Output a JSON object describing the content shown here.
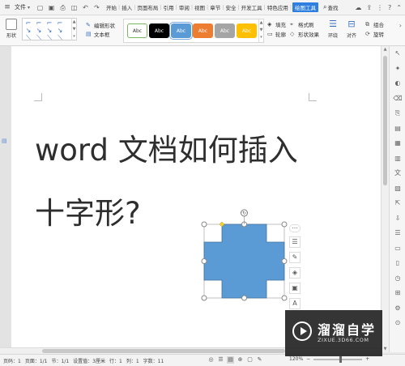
{
  "menubar": {
    "file_label": "文件",
    "tabs": [
      "开始",
      "插入",
      "页面布局",
      "引用",
      "审阅",
      "视图",
      "章节",
      "安全",
      "开发工具",
      "特色应用"
    ],
    "active_tab": "绘图工具",
    "search_label": "查找"
  },
  "ribbon": {
    "shape_label": "形状",
    "edit_shape_label": "编辑形状",
    "textbox_label": "文本框",
    "style_swatches": [
      {
        "label": "Abc",
        "bg": "#ffffff",
        "fg": "#333333",
        "border": "#7bb661"
      },
      {
        "label": "Abc",
        "bg": "#000000",
        "fg": "#ffffff",
        "border": "#000000"
      },
      {
        "label": "Abc",
        "bg": "#5b9bd5",
        "fg": "#ffffff",
        "border": "#5b9bd5"
      },
      {
        "label": "Abc",
        "bg": "#ed7d31",
        "fg": "#ffffff",
        "border": "#ed7d31"
      },
      {
        "label": "Abc",
        "bg": "#a5a5a5",
        "fg": "#ffffff",
        "border": "#a5a5a5"
      },
      {
        "label": "Abc",
        "bg": "#ffc000",
        "fg": "#ffffff",
        "border": "#ffc000"
      }
    ],
    "fill_label": "填充",
    "outline_label": "轮廓",
    "format_painter_label": "格式刷",
    "shape_effects_label": "形状效果",
    "wrap_label": "环绕",
    "align_label": "对齐",
    "group_label": "组合",
    "rotate_label": "旋转"
  },
  "document": {
    "line1": "word 文档如何插入",
    "line2": "十字形?"
  },
  "shape": {
    "fill_color": "#5b9bd5",
    "stroke_color": "#41719c"
  },
  "statusbar": {
    "page_num": "页码：1",
    "pages": "页面：1/1",
    "section": "节：1/1",
    "setting": "设置值：3厘米",
    "row": "行：1",
    "col": "列：1",
    "words": "字数：11",
    "zoom": "120%",
    "zoom_fraction": 0.55
  },
  "watermark": {
    "brand": "溜溜自学",
    "url": "ZIXUE.3D66.COM"
  }
}
